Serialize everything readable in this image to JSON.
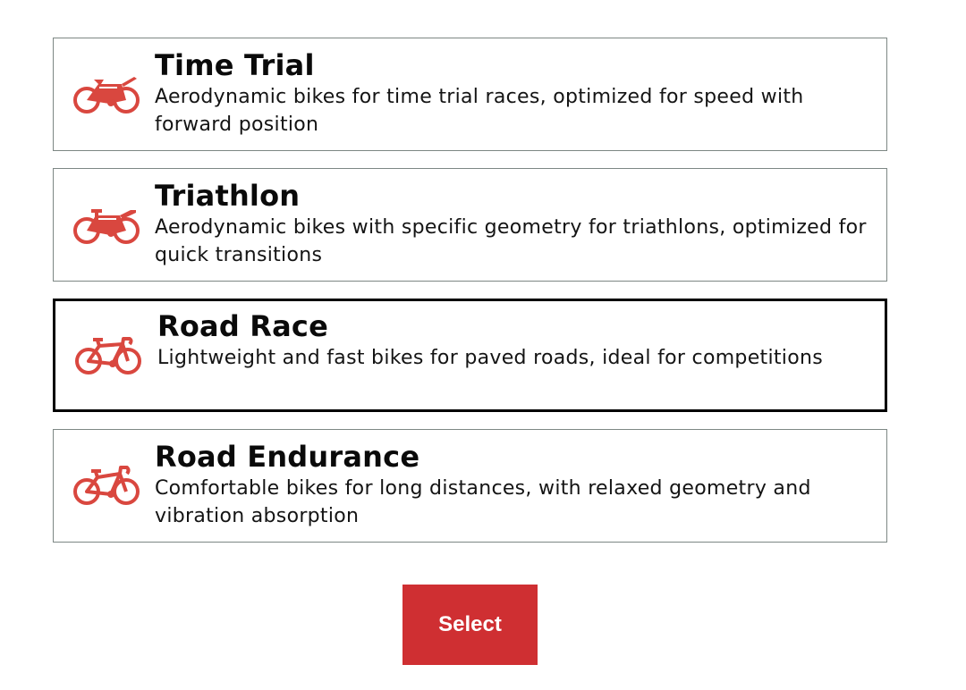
{
  "options": [
    {
      "icon": "bike-icon",
      "title": "Time Trial",
      "description": "Aerodynamic bikes for time trial races, optimized for speed with forward position",
      "selected": false
    },
    {
      "icon": "bike-icon",
      "title": "Triathlon",
      "description": "Aerodynamic bikes with specific geometry for triathlons, optimized for quick transitions",
      "selected": false
    },
    {
      "icon": "bike-icon",
      "title": "Road Race",
      "description": "Lightweight and fast bikes for paved roads, ideal for competitions",
      "selected": true
    },
    {
      "icon": "bike-icon",
      "title": "Road Endurance",
      "description": "Comfortable bikes for long distances, with relaxed geometry and vibration absorption",
      "selected": false
    }
  ],
  "select_button": {
    "label": "Select"
  },
  "colors": {
    "accent": "#cf2f32",
    "icon": "#d9473f",
    "border": "#7d8784",
    "selected_border": "#000000"
  }
}
